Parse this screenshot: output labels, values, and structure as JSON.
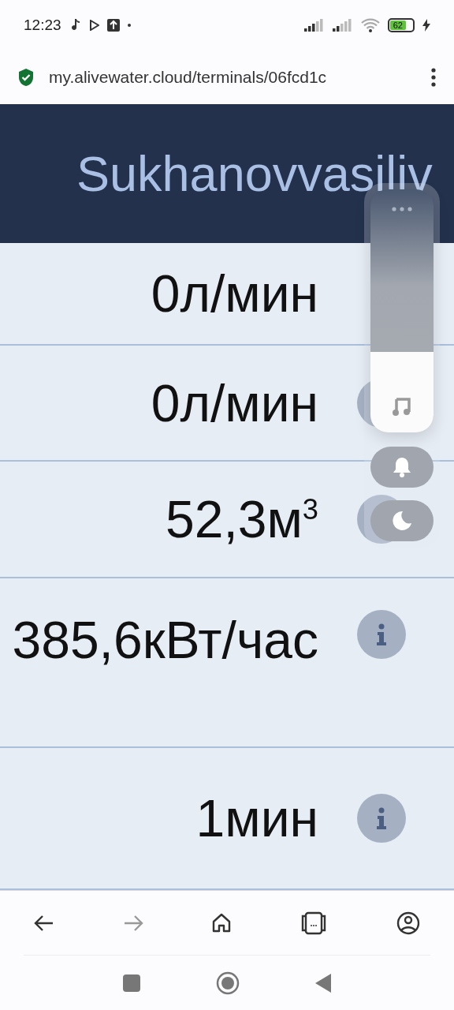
{
  "status_bar": {
    "time": "12:23",
    "battery": "62"
  },
  "address_bar": {
    "url": "my.alivewater.cloud/terminals/06fcd1c"
  },
  "header": {
    "title": "Sukhanovvasiliv"
  },
  "rows": [
    {
      "value": "0л/мин",
      "info_button": false
    },
    {
      "value": "0л/мин",
      "info_button": true
    },
    {
      "value": "52,3м$^{3}$",
      "info_button": true
    },
    {
      "value": "385,6кВт/час",
      "info_button": true
    },
    {
      "value": "1мин",
      "info_button": true
    }
  ],
  "volume_panel": {
    "level": 0.33
  }
}
